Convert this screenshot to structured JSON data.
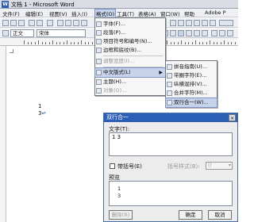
{
  "window": {
    "title": "文档 1 - Microsoft Word"
  },
  "menubar": [
    "文件(F)",
    "编辑(E)",
    "视图(V)",
    "插入(I)",
    "格式(O)",
    "工具(T)",
    "表格(A)",
    "窗口(W)",
    "帮助",
    "Adobe P"
  ],
  "toolbar": {
    "style": "正文",
    "font": "宋体"
  },
  "document": {
    "line1": "1",
    "line2": "3"
  },
  "format_menu": [
    {
      "label": "字体(F)...",
      "state": "normal",
      "icon": "font-icon"
    },
    {
      "label": "段落(P)...",
      "state": "normal",
      "icon": "paragraph-icon"
    },
    {
      "label": "项目符号和编号(N)...",
      "state": "normal",
      "icon": "bullets-icon"
    },
    {
      "label": "边框和底纹(B)...",
      "state": "normal",
      "icon": "borders-icon"
    },
    {
      "label": "调整宽度(I)...",
      "state": "disabled",
      "icon": "width-icon"
    },
    {
      "label": "中文版式(L)",
      "state": "selected",
      "icon": "chinese-layout-icon",
      "submenu": true
    },
    {
      "label": "主题(H)...",
      "state": "normal",
      "icon": "theme-icon"
    },
    {
      "label": "对象(O)...",
      "state": "disabled",
      "icon": "object-icon"
    }
  ],
  "submenu": [
    {
      "label": "拼音指南(U)...",
      "state": "normal",
      "icon": "phonetic-icon"
    },
    {
      "label": "带圈字符(E)...",
      "state": "normal",
      "icon": "enclosed-char-icon"
    },
    {
      "label": "纵横混排(V)...",
      "state": "normal",
      "icon": "horizontal-in-vertical-icon"
    },
    {
      "label": "合并字符(M)...",
      "state": "normal",
      "icon": "combine-chars-icon"
    },
    {
      "label": "双行合一(W)...",
      "state": "selected",
      "icon": "two-lines-in-one-icon"
    }
  ],
  "dialog": {
    "title": "双行合一",
    "text_label": "文字(T):",
    "text_value": "1 3",
    "bracket_label": "带括号(E)",
    "bracket_style_label": "括号样式(B):",
    "bracket_style_value": "()",
    "preview_label": "预览",
    "preview_line1": "1",
    "preview_line2": "3",
    "remove_button": "删除(R)",
    "ok_button": "确定",
    "cancel_button": "取消",
    "close_glyph": "×"
  }
}
